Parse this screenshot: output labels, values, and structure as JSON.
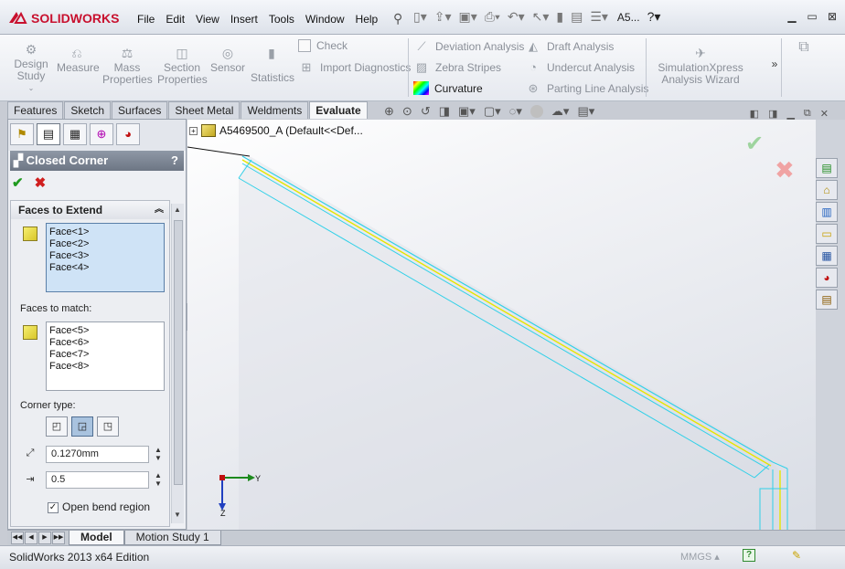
{
  "app": {
    "logo_text": "SOLIDWORKS",
    "document_name": "A5..."
  },
  "menu": {
    "items": [
      "File",
      "Edit",
      "View",
      "Insert",
      "Tools",
      "Window",
      "Help"
    ]
  },
  "ribbon": {
    "design_study": "Design Study",
    "measure": "Measure",
    "mass_properties": "Mass Properties",
    "section_properties": "Section Properties",
    "sensor": "Sensor",
    "statistics": "Statistics",
    "check": "Check",
    "import_diagnostics": "Import Diagnostics",
    "deviation_analysis": "Deviation Analysis",
    "zebra_stripes": "Zebra Stripes",
    "curvature": "Curvature",
    "draft_analysis": "Draft Analysis",
    "undercut_analysis": "Undercut Analysis",
    "parting_line_analysis": "Parting Line Analysis",
    "simulationxpress": "SimulationXpress Analysis Wizard",
    "more": "»"
  },
  "tabs": {
    "items": [
      "Features",
      "Sketch",
      "Surfaces",
      "Sheet Metal",
      "Weldments",
      "Evaluate"
    ],
    "active": "Evaluate"
  },
  "property_manager": {
    "title": "Closed Corner",
    "help": "?",
    "ok": "✔",
    "cancel": "✖",
    "group_title": "Faces to Extend",
    "faces_to_extend": [
      "Face<1>",
      "Face<2>",
      "Face<3>",
      "Face<4>"
    ],
    "faces_to_match_label": "Faces to match:",
    "faces_to_match": [
      "Face<5>",
      "Face<6>",
      "Face<7>",
      "Face<8>"
    ],
    "corner_type_label": "Corner type:",
    "gap_distance": "0.1270mm",
    "overlap_ratio": "0.5",
    "open_bend_region": "Open bend region",
    "open_bend_checked": true
  },
  "viewport": {
    "tree_root": "A5469500_A  (Default<<Def..."
  },
  "bottom_tabs": {
    "items": [
      "Model",
      "Motion Study 1"
    ],
    "active": "Model"
  },
  "status": {
    "edition": "SolidWorks 2013 x64 Edition",
    "units": "MMGS",
    "help_badge": "?"
  },
  "colors": {
    "accent_red": "#c8102e",
    "edge_yellow": "#e6e600",
    "edge_cyan": "#30d0e8",
    "selection_blue": "#cfe3f6"
  }
}
